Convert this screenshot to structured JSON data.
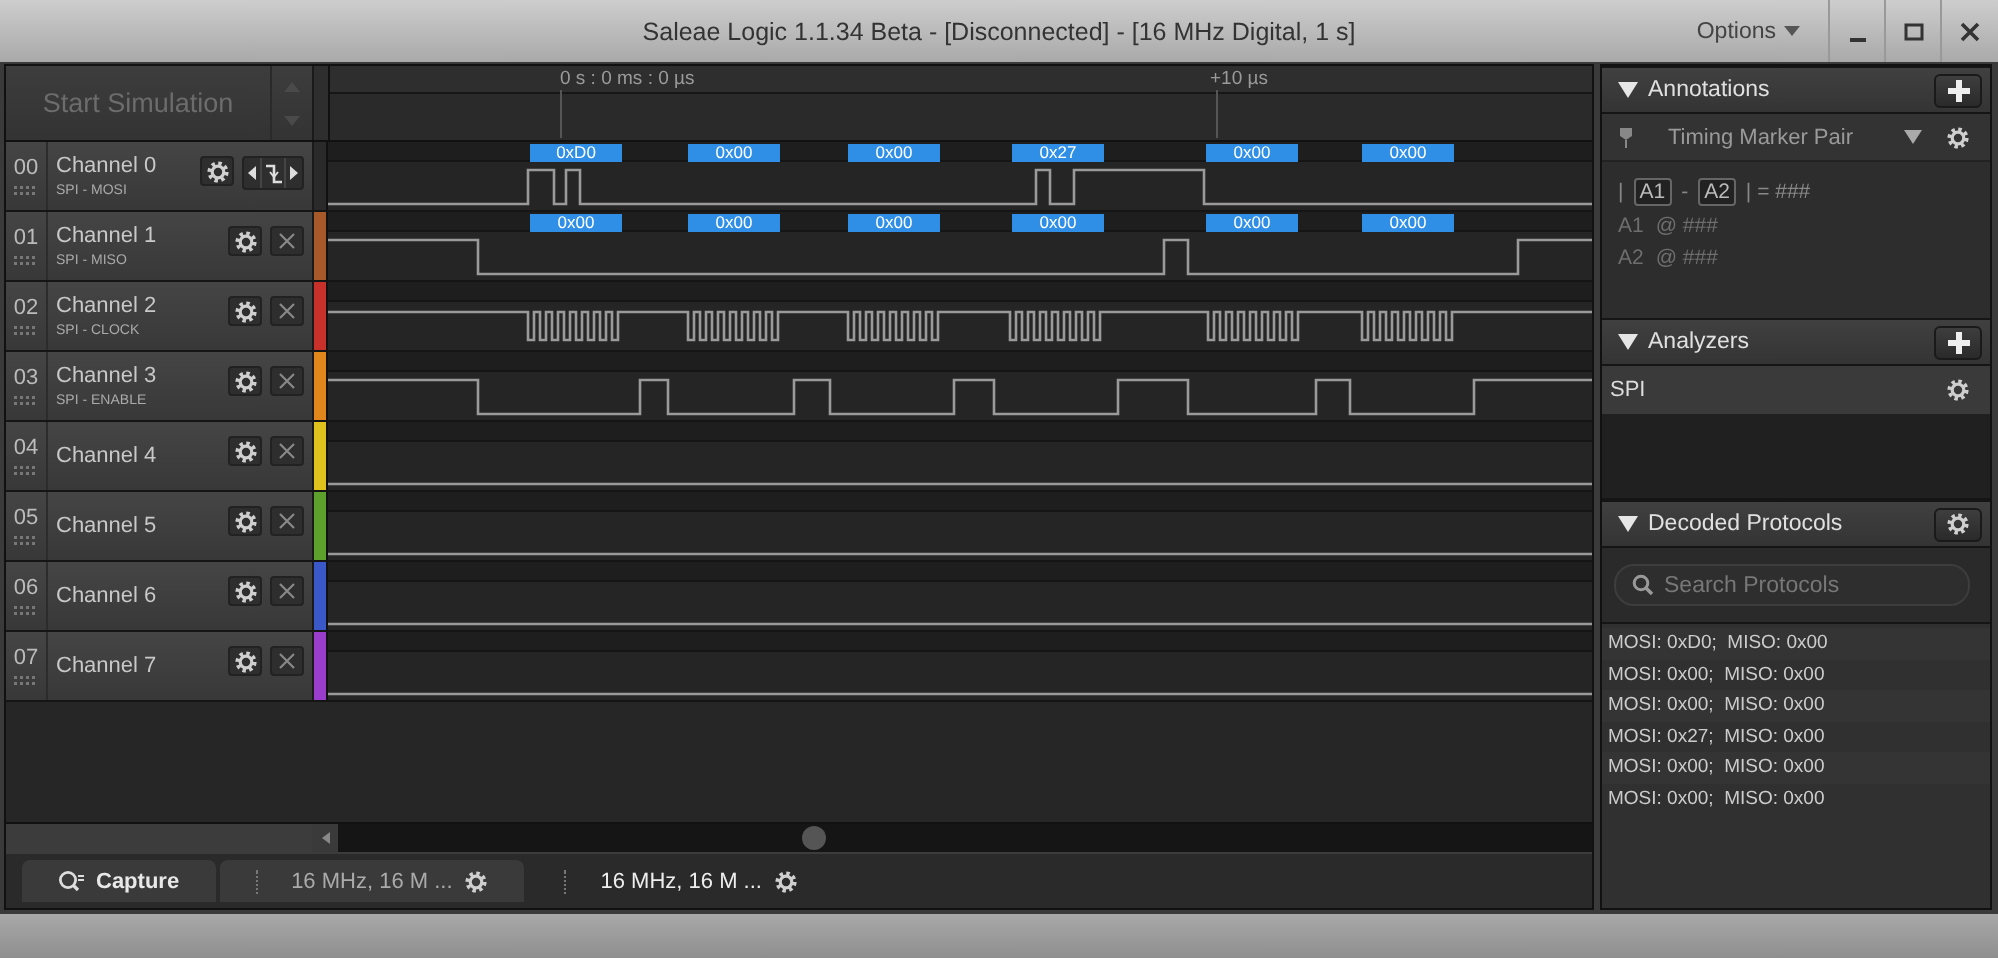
{
  "window": {
    "title": "Saleae Logic 1.1.34 Beta - [Disconnected] - [16 MHz Digital, 1 s]",
    "menu": "Options"
  },
  "simulation": {
    "label": "Start Simulation"
  },
  "ruler": {
    "labels": [
      "0 s : 0 ms : 0 µs",
      "+10 µs"
    ]
  },
  "channels": [
    {
      "number": "00",
      "name": "Channel 0",
      "subtitle": "SPI - MOSI",
      "color": "#2a2a2a",
      "kind": "trigger",
      "decoded": [
        "0xD0",
        "0x00",
        "0x00",
        "0x27",
        "0x00",
        "0x00"
      ]
    },
    {
      "number": "01",
      "name": "Channel 1",
      "subtitle": "SPI - MISO",
      "color": "#a8592a",
      "kind": "standard",
      "decoded": [
        "0x00",
        "0x00",
        "0x00",
        "0x00",
        "0x00",
        "0x00"
      ]
    },
    {
      "number": "02",
      "name": "Channel 2",
      "subtitle": "SPI - CLOCK",
      "color": "#c8302a",
      "kind": "standard"
    },
    {
      "number": "03",
      "name": "Channel 3",
      "subtitle": "SPI - ENABLE",
      "color": "#e0861c",
      "kind": "standard"
    },
    {
      "number": "04",
      "name": "Channel 4",
      "color": "#e0c21c",
      "kind": "standard"
    },
    {
      "number": "05",
      "name": "Channel 5",
      "color": "#5ea02c",
      "kind": "standard"
    },
    {
      "number": "06",
      "name": "Channel 6",
      "color": "#3a58c8",
      "kind": "standard"
    },
    {
      "number": "07",
      "name": "Channel 7",
      "color": "#9a3ccc",
      "kind": "standard"
    }
  ],
  "annotations": {
    "title": "Annotations",
    "marker": "Timing Marker Pair",
    "formula": {
      "opening": "|",
      "first": "A1",
      "separator": "-",
      "second": "A2",
      "result": "| = ###"
    },
    "rows": [
      {
        "marker": "A1",
        "value": "@ ###"
      },
      {
        "marker": "A2",
        "value": "@ ###"
      }
    ]
  },
  "analyzers": {
    "title": "Analyzers",
    "items": [
      "SPI"
    ]
  },
  "decoded_protocols": {
    "title": "Decoded Protocols",
    "search": {
      "placeholder": "Search Protocols"
    },
    "rows": [
      "MOSI: 0xD0;  MISO: 0x00",
      "MOSI: 0x00;  MISO: 0x00",
      "MOSI: 0x00;  MISO: 0x00",
      "MOSI: 0x27;  MISO: 0x00",
      "MOSI: 0x00;  MISO: 0x00",
      "MOSI: 0x00;  MISO: 0x00"
    ]
  },
  "tabs": [
    {
      "label": "Capture",
      "kind": "capture",
      "selected": false
    },
    {
      "label": "16 MHz, 16 M ...",
      "kind": "session",
      "selected": false
    },
    {
      "label": "16 MHz, 16 M ...",
      "kind": "session",
      "selected": true
    }
  ]
}
